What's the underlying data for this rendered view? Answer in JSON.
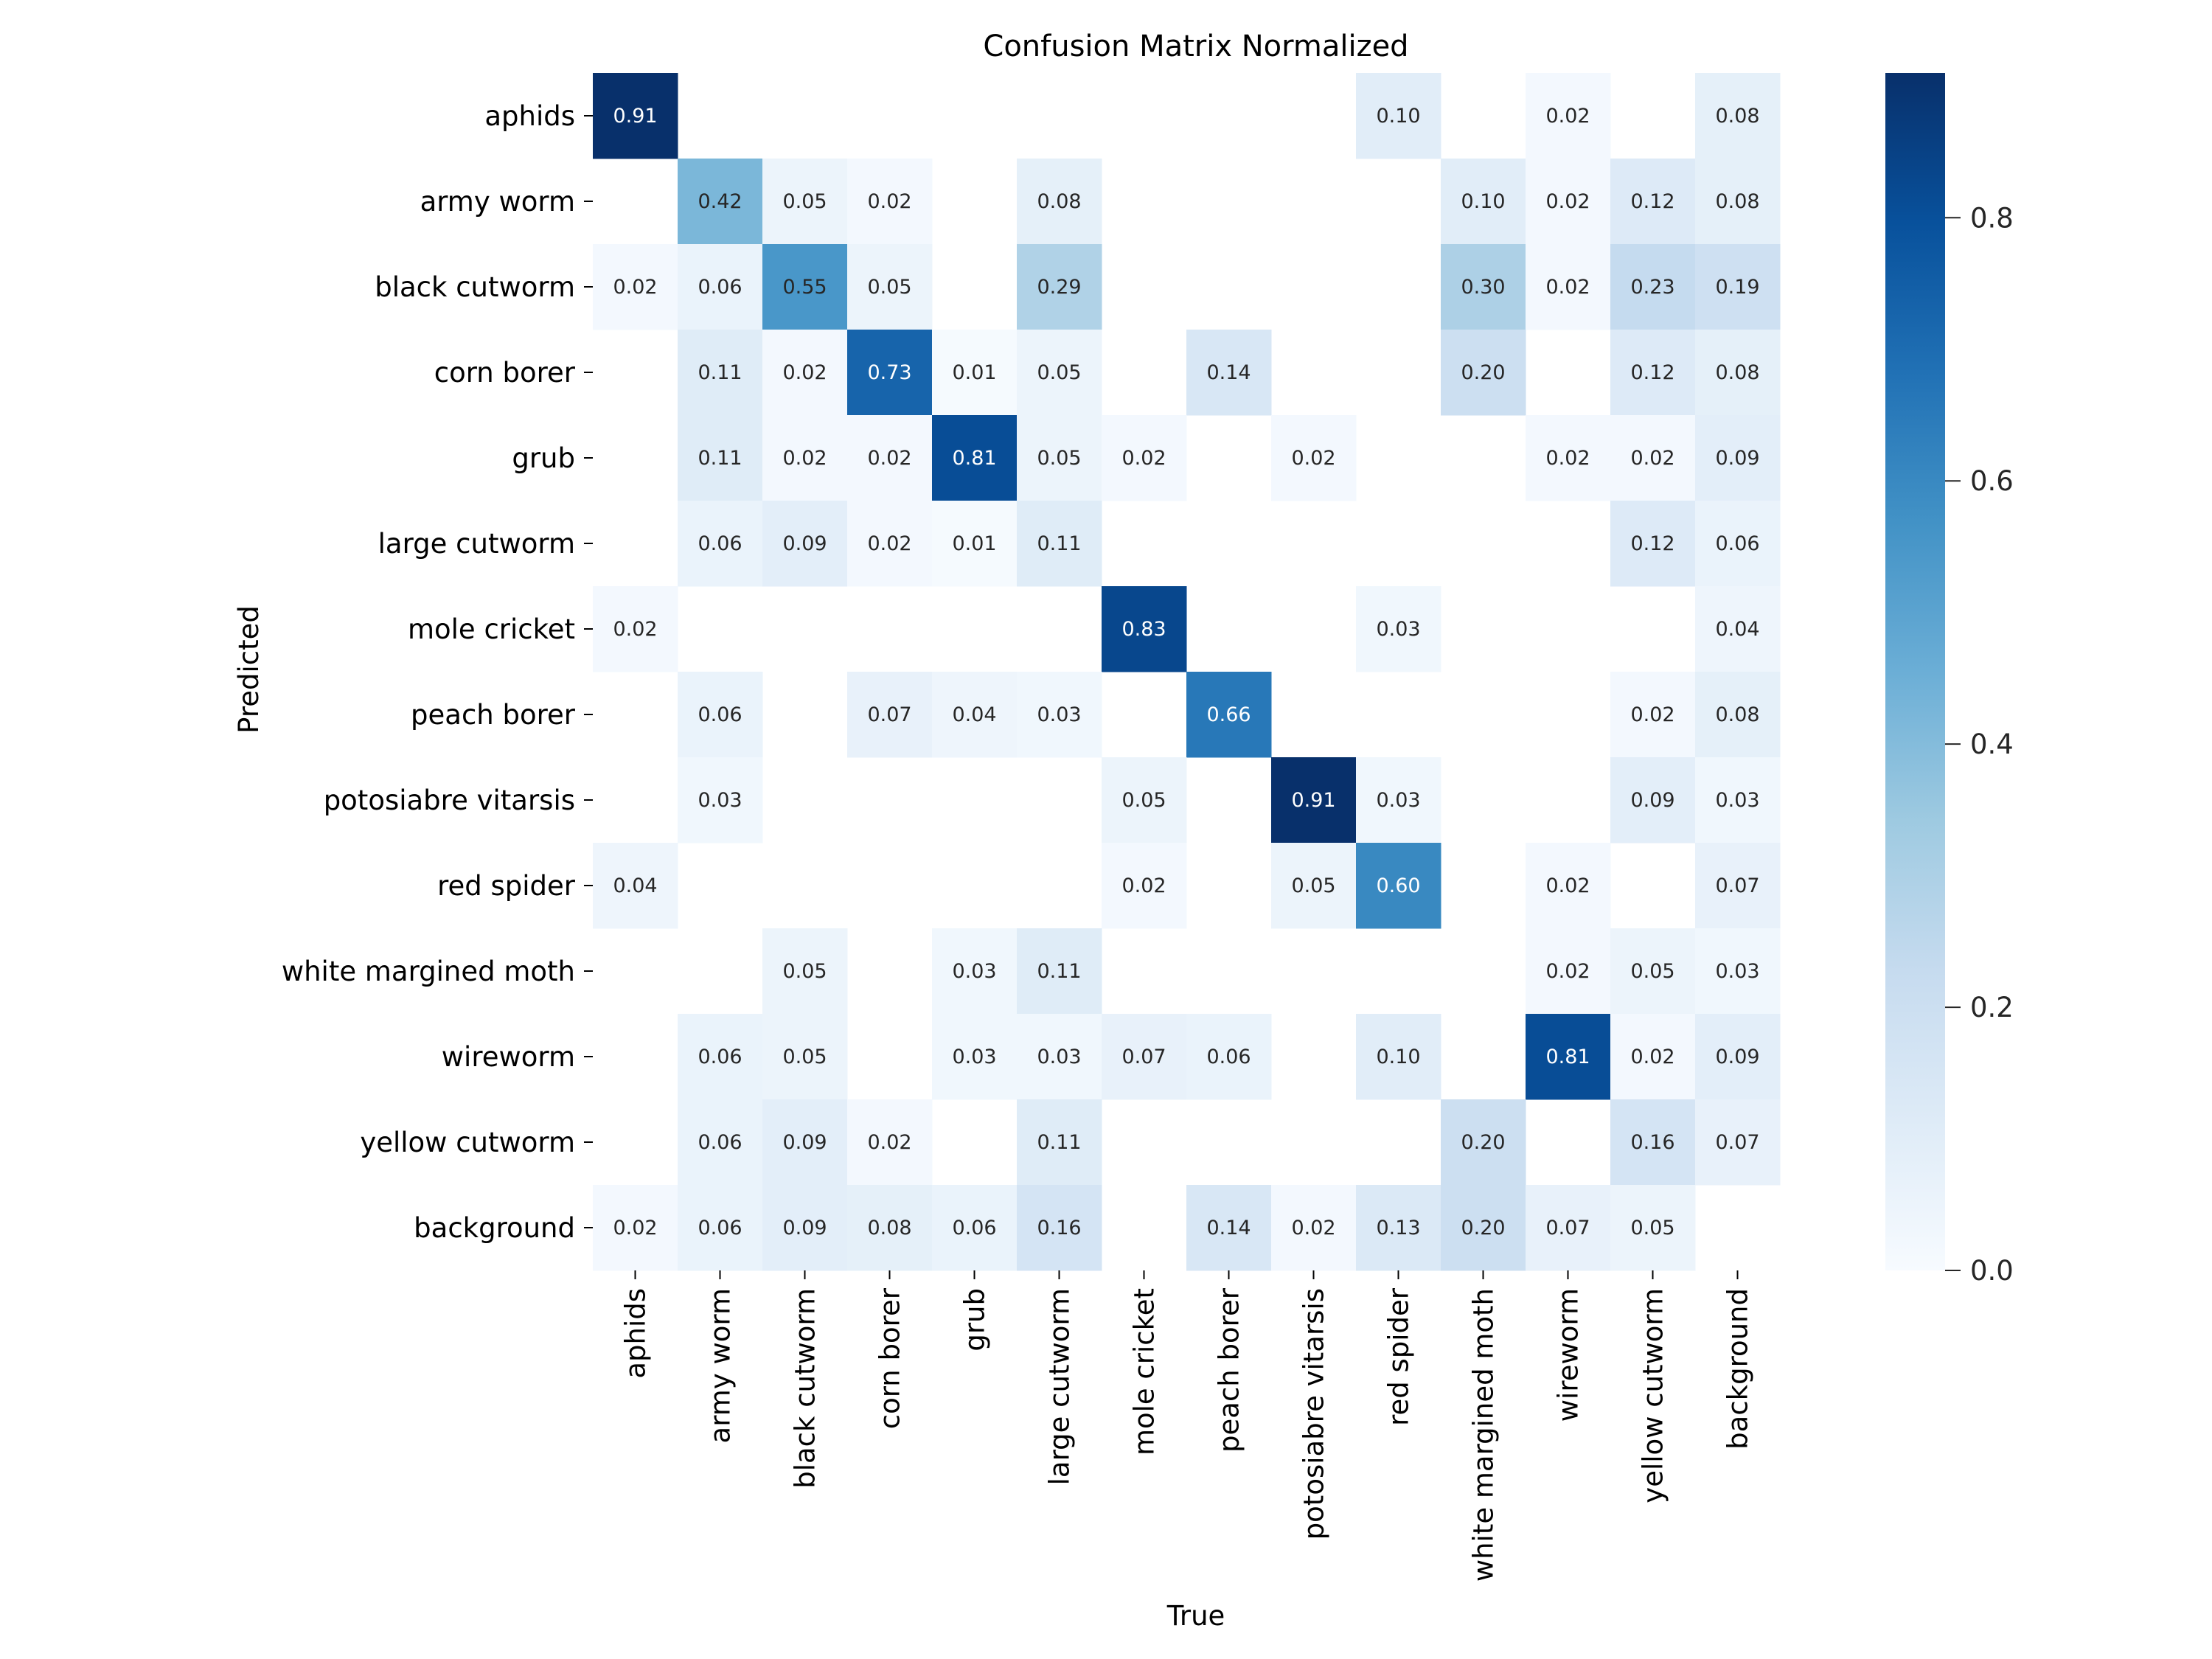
{
  "chart_data": {
    "type": "heatmap",
    "title": "Confusion Matrix Normalized",
    "xlabel": "True",
    "ylabel": "Predicted",
    "colormap": "Blues",
    "colormap_stops": [
      "#f7fbff",
      "#deebf7",
      "#c6dbef",
      "#9ecae1",
      "#6baed6",
      "#4292c6",
      "#2171b5",
      "#08519c",
      "#08306b"
    ],
    "vmin": 0.0,
    "vmax": 0.91,
    "colorbar": {
      "ticks": [
        0.0,
        0.2,
        0.4,
        0.6,
        0.8
      ],
      "tick_labels": [
        "0.0",
        "0.2",
        "0.4",
        "0.6",
        "0.8"
      ],
      "placement": "right"
    },
    "annotation_format": "0.00",
    "hide_zero_cells": true,
    "x_categories": [
      "aphids",
      "army worm",
      "black cutworm",
      "corn borer",
      "grub",
      "large cutworm",
      "mole cricket",
      "peach borer",
      "potosiabre vitarsis",
      "red spider",
      "white margined moth",
      "wireworm",
      "yellow cutworm",
      "background"
    ],
    "y_categories": [
      "aphids",
      "army worm",
      "black cutworm",
      "corn borer",
      "grub",
      "large cutworm",
      "mole cricket",
      "peach borer",
      "potosiabre vitarsis",
      "red spider",
      "white margined moth",
      "wireworm",
      "yellow cutworm",
      "background"
    ],
    "values": [
      [
        0.91,
        0,
        0,
        0,
        0,
        0,
        0,
        0,
        0,
        0.1,
        0,
        0.02,
        0,
        0.08
      ],
      [
        0,
        0.42,
        0.05,
        0.02,
        0,
        0.08,
        0,
        0,
        0,
        0,
        0.1,
        0.02,
        0.12,
        0.08
      ],
      [
        0.02,
        0.06,
        0.55,
        0.05,
        0,
        0.29,
        0,
        0,
        0,
        0,
        0.3,
        0.02,
        0.23,
        0.19
      ],
      [
        0,
        0.11,
        0.02,
        0.73,
        0.01,
        0.05,
        0,
        0.14,
        0,
        0,
        0.2,
        0,
        0.12,
        0.08
      ],
      [
        0,
        0.11,
        0.02,
        0.02,
        0.81,
        0.05,
        0.02,
        0,
        0.02,
        0,
        0,
        0.02,
        0.02,
        0.09
      ],
      [
        0,
        0.06,
        0.09,
        0.02,
        0.01,
        0.11,
        0,
        0,
        0,
        0,
        0,
        0,
        0.12,
        0.06
      ],
      [
        0.02,
        0,
        0,
        0,
        0,
        0,
        0.83,
        0,
        0,
        0.03,
        0,
        0,
        0,
        0.04
      ],
      [
        0,
        0.06,
        0,
        0.07,
        0.04,
        0.03,
        0,
        0.66,
        0,
        0,
        0,
        0,
        0.02,
        0.08
      ],
      [
        0,
        0.03,
        0,
        0,
        0,
        0,
        0.05,
        0,
        0.91,
        0.03,
        0,
        0,
        0.09,
        0.03
      ],
      [
        0.04,
        0,
        0,
        0,
        0,
        0,
        0.02,
        0,
        0.05,
        0.6,
        0,
        0.02,
        0,
        0.07
      ],
      [
        0,
        0,
        0.05,
        0,
        0.03,
        0.11,
        0,
        0,
        0,
        0,
        0,
        0.02,
        0.05,
        0.03
      ],
      [
        0,
        0.06,
        0.05,
        0,
        0.03,
        0.03,
        0.07,
        0.06,
        0,
        0.1,
        0,
        0.81,
        0.02,
        0.09
      ],
      [
        0,
        0.06,
        0.09,
        0.02,
        0,
        0.11,
        0,
        0,
        0,
        0,
        0.2,
        0,
        0.16,
        0.07
      ],
      [
        0.02,
        0.06,
        0.09,
        0.08,
        0.06,
        0.16,
        0,
        0.14,
        0.02,
        0.13,
        0.2,
        0.07,
        0.05,
        0
      ]
    ]
  }
}
